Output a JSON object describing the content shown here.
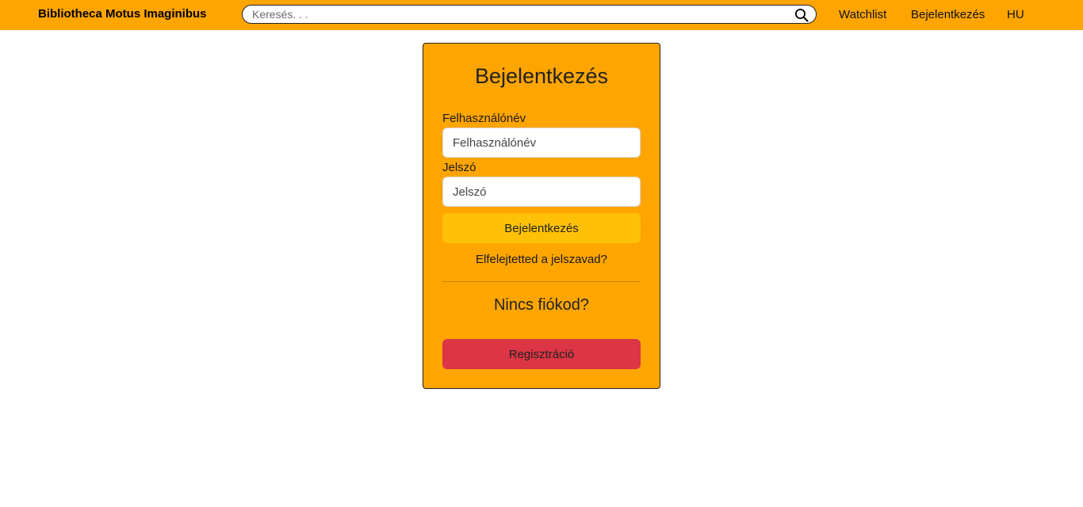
{
  "navbar": {
    "brand": "Bibliotheca Motus Imaginibus",
    "search": {
      "placeholder": "Keresés. . ."
    },
    "links": {
      "watchlist": "Watchlist",
      "login": "Bejelentkezés",
      "language": "HU"
    },
    "background_color": "#FFA500"
  },
  "login_card": {
    "title": "Bejelentkezés",
    "username": {
      "label": "Felhasználónév",
      "placeholder": "Felhasználónév",
      "value": ""
    },
    "password": {
      "label": "Jelszó",
      "placeholder": "Jelszó",
      "value": ""
    },
    "submit_label": "Bejelentkezés",
    "forgot_password": "Elfelejtetted a jelszavad?",
    "no_account": "Nincs fiókod?",
    "register_label": "Regisztráció",
    "background_color": "#FFA500",
    "submit_color": "#FFC107",
    "register_color": "#DC3545"
  },
  "icons": {
    "search": "search-icon"
  }
}
